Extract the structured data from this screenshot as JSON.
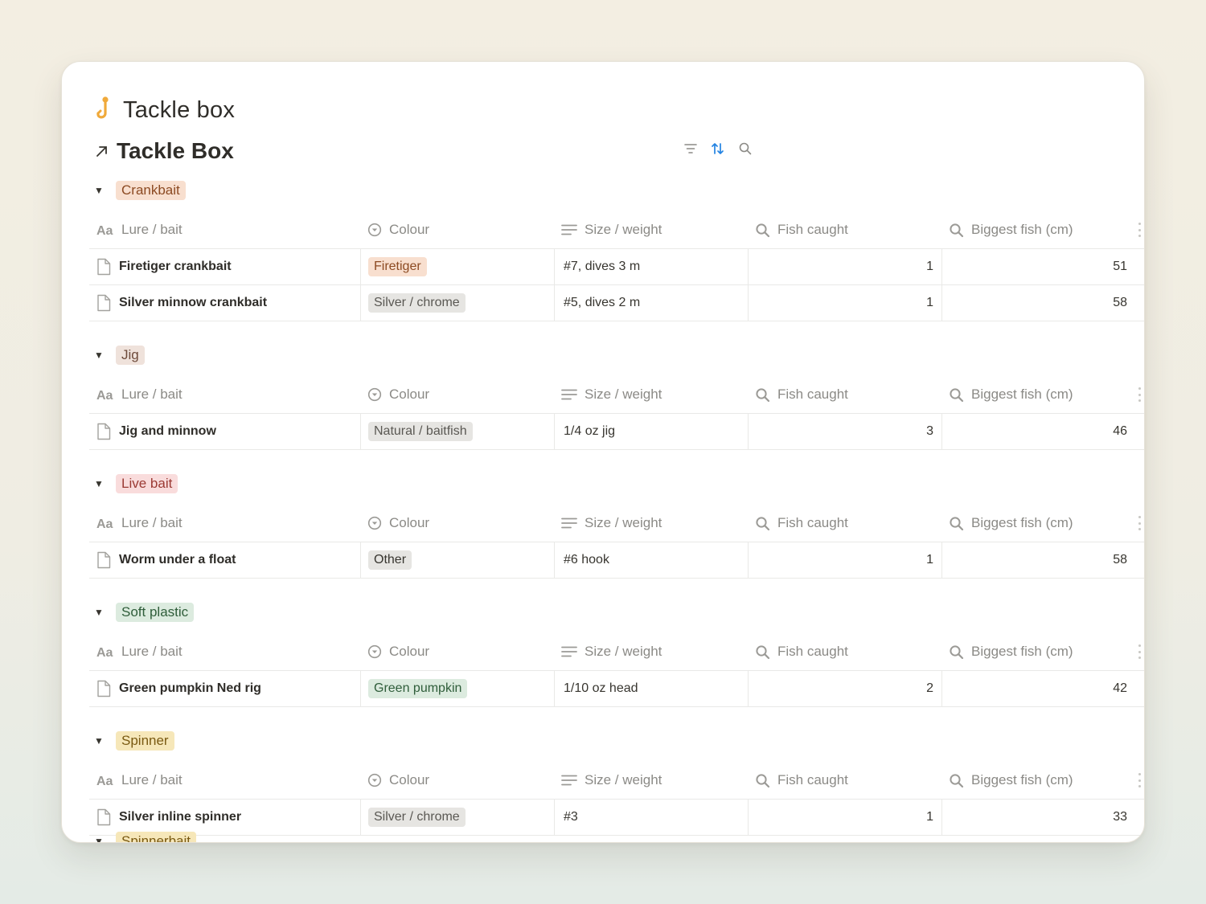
{
  "page": {
    "title": "Tackle box",
    "icon": "hook-icon"
  },
  "database": {
    "title": "Tackle Box",
    "link_icon": "arrow-up-right-icon"
  },
  "toolbar": {
    "icons": [
      "filter-icon",
      "sort-icon",
      "search-icon"
    ],
    "active_color": "#2383e2"
  },
  "columns": {
    "lure": "Lure / bait",
    "colour": "Colour",
    "size": "Size / weight",
    "caught": "Fish caught",
    "biggest": "Biggest fish (cm)"
  },
  "groups": [
    {
      "name": "Crankbait",
      "tag_bg": "#f8dfcf",
      "tag_fg": "#8c4a22",
      "rows": [
        {
          "lure": "Firetiger crankbait",
          "colour": "Firetiger",
          "colour_bg": "#f8dfcf",
          "colour_fg": "#8c4a22",
          "size": "#7, dives 3 m",
          "caught": "1",
          "biggest": "51"
        },
        {
          "lure": "Silver minnow crankbait",
          "colour": "Silver / chrome",
          "colour_bg": "#e6e5e2",
          "colour_fg": "#5a5853",
          "size": "#5, dives 2 m",
          "caught": "1",
          "biggest": "58"
        }
      ]
    },
    {
      "name": "Jig",
      "tag_bg": "#efe2db",
      "tag_fg": "#6e4a3a",
      "rows": [
        {
          "lure": "Jig and minnow",
          "colour": "Natural / baitfish",
          "colour_bg": "#e6e5e2",
          "colour_fg": "#5a5853",
          "size": "1/4 oz jig",
          "caught": "3",
          "biggest": "46"
        }
      ]
    },
    {
      "name": "Live bait",
      "tag_bg": "#f9dcdc",
      "tag_fg": "#9b3a34",
      "rows": [
        {
          "lure": "Worm under a float",
          "colour": "Other",
          "colour_bg": "#e6e5e2",
          "colour_fg": "#37352f",
          "size": "#6 hook",
          "caught": "1",
          "biggest": "58"
        }
      ]
    },
    {
      "name": "Soft plastic",
      "tag_bg": "#dcebdf",
      "tag_fg": "#2f5d3a",
      "rows": [
        {
          "lure": "Green pumpkin Ned rig",
          "colour": "Green pumpkin",
          "colour_bg": "#dcebdf",
          "colour_fg": "#2f5d3a",
          "size": "1/10 oz head",
          "caught": "2",
          "biggest": "42"
        }
      ]
    },
    {
      "name": "Spinner",
      "tag_bg": "#f6e7b9",
      "tag_fg": "#7a5a12",
      "rows": [
        {
          "lure": "Silver inline spinner",
          "colour": "Silver / chrome",
          "colour_bg": "#e6e5e2",
          "colour_fg": "#5a5853",
          "size": "#3",
          "caught": "1",
          "biggest": "33"
        }
      ]
    }
  ],
  "partial_group": {
    "name": "Spinnerbait",
    "tag_bg": "#f6e7b9",
    "tag_fg": "#7a5a12"
  }
}
